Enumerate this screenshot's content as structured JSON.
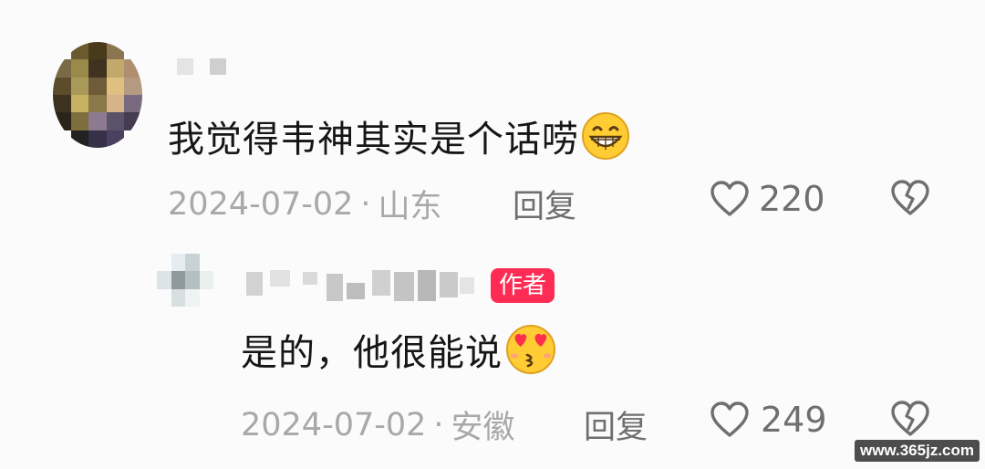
{
  "comments": [
    {
      "text": "我觉得韦神其实是个话唠",
      "emoji": "grinning-face",
      "date": "2024-07-02",
      "location": "山东",
      "reply_label": "回复",
      "like_count": "220"
    },
    {
      "author_badge": "作者",
      "text": "是的，他很能说",
      "emoji": "kissing-face-heart-eyes",
      "date": "2024-07-02",
      "location": "安徽",
      "reply_label": "回复",
      "like_count": "249"
    }
  ],
  "separator": "·",
  "watermark": "www.365jz.com",
  "colors": {
    "badge": "#fe2c55",
    "meta_text": "#a8a8a8",
    "action_text": "#6f6f6f"
  }
}
